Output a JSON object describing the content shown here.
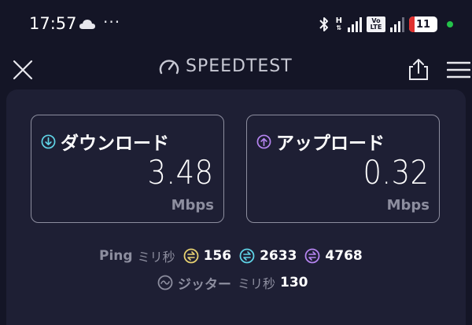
{
  "status_bar": {
    "time": "17:57",
    "overflow": "···",
    "network_type": "H",
    "volte_label": "Vo LTE",
    "battery_level": "11",
    "icons": [
      "cloud-icon",
      "bluetooth-icon",
      "signal-icon",
      "volte-icon",
      "battery-icon"
    ]
  },
  "header": {
    "title": "SPEEDTEST",
    "icons": [
      "close-icon",
      "speedometer-icon",
      "share-icon",
      "menu-icon"
    ]
  },
  "download": {
    "label": "ダウンロード",
    "value": "3.48",
    "unit": "Mbps",
    "color": "#5fd3e6"
  },
  "upload": {
    "label": "アップロード",
    "value": "0.32",
    "unit": "Mbps",
    "color": "#b584f0"
  },
  "ping": {
    "label": "Ping",
    "unit": "ミリ秒",
    "idle": "156",
    "download": "2633",
    "upload": "4768",
    "idle_color": "#e8d271"
  },
  "jitter": {
    "label": "ジッター",
    "unit": "ミリ秒",
    "value": "130"
  },
  "colors": {
    "background": "#141526",
    "panel": "#1e1f34",
    "muted": "#8d8e9f",
    "battery_low": "#e0312f",
    "active_dot": "#24c24a"
  }
}
